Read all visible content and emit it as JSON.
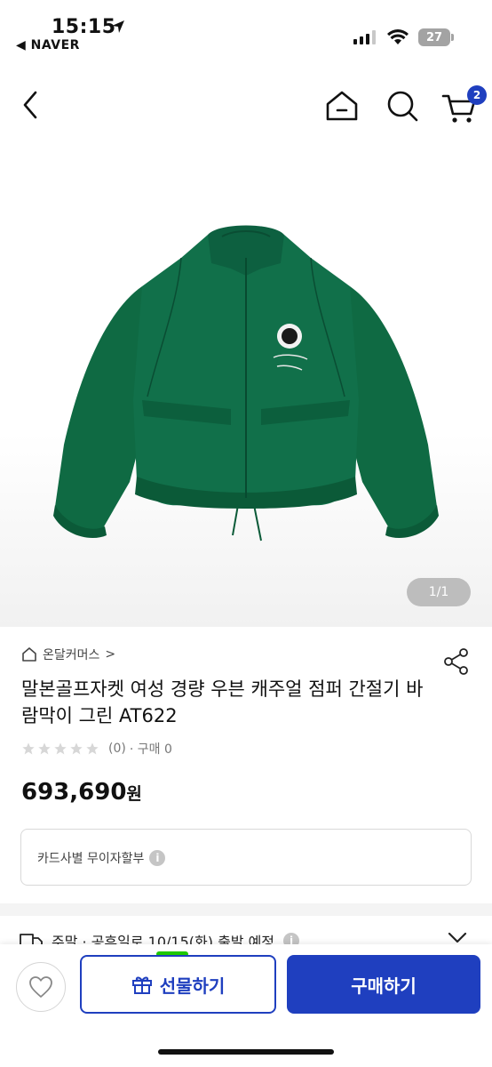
{
  "status_bar": {
    "time": "15:15",
    "back_app": "◀ NAVER",
    "battery": "27"
  },
  "nav": {
    "cart_count": "2"
  },
  "image": {
    "page_indicator": "1/1"
  },
  "product": {
    "store": "온달커머스",
    "store_chevron": ">",
    "title": "말본골프자켓 여성 경량 우븐 캐주얼 점퍼 간절기 바람막이 그린 AT622",
    "rating_count": "(0)",
    "purchase_count": "· 구매 0",
    "price": "693,690",
    "price_unit": "원",
    "card_benefit": "카드사별 무이자할부",
    "delivery": "주말 · 공휴일로 10/15(화) 출발 예정"
  },
  "actions": {
    "gift_label": "선물하기",
    "buy_label": "구매하기"
  },
  "colors": {
    "brand_blue": "#1f3fbf",
    "jacket_green": "#0f6a43",
    "accent_green": "#1ec800"
  }
}
